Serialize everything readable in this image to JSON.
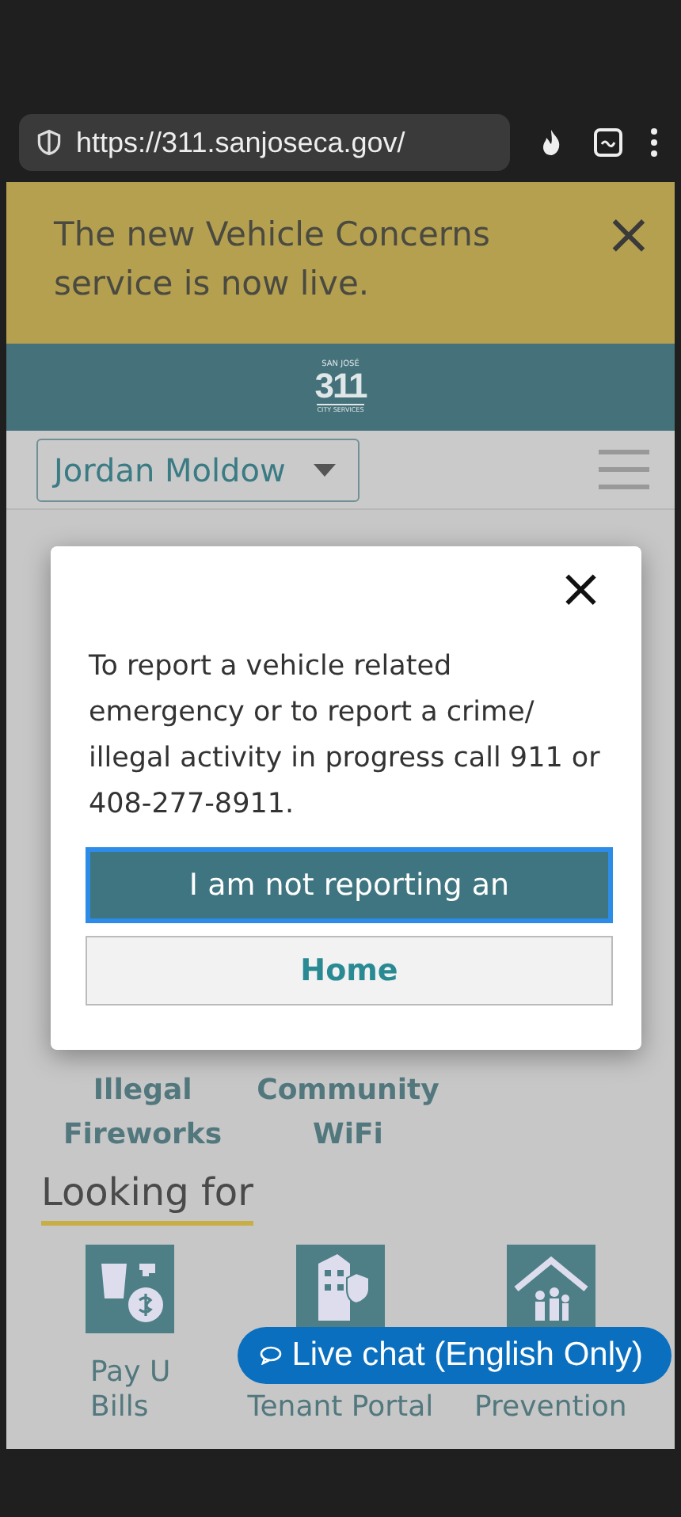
{
  "browser": {
    "url": "https://311.sanjoseca.gov/"
  },
  "banner": {
    "message": "The new Vehicle Concerns service is now live.",
    "close": "×"
  },
  "header": {
    "logo_top": "SAN JOSÉ",
    "logo_number": "311",
    "logo_bottom": "CITY SERVICES"
  },
  "nav": {
    "user": "Jordan Moldow"
  },
  "services": [
    {
      "lines": [
        "Illegal",
        "Fireworks"
      ]
    },
    {
      "lines": [
        "Community",
        "WiFi"
      ]
    }
  ],
  "looking_for": {
    "title": "Looking for",
    "tiles": [
      {
        "kind": "bills",
        "lines": [
          "Pay U",
          "Bills"
        ]
      },
      {
        "kind": "rent",
        "lines": [
          "Tenant Portal"
        ]
      },
      {
        "kind": "home",
        "lines": [
          "Prevention"
        ]
      }
    ]
  },
  "dialog": {
    "close": "×",
    "message": "To report a vehicle related emergency or to report a crime/ illegal activity in progress call 911 or 408-277-8911.",
    "buttons": [
      {
        "label": "I am not reporting an",
        "kind": "primary"
      },
      {
        "label": "Home",
        "kind": "secondary"
      }
    ]
  },
  "chat": {
    "label": "Live chat (English Only)"
  }
}
